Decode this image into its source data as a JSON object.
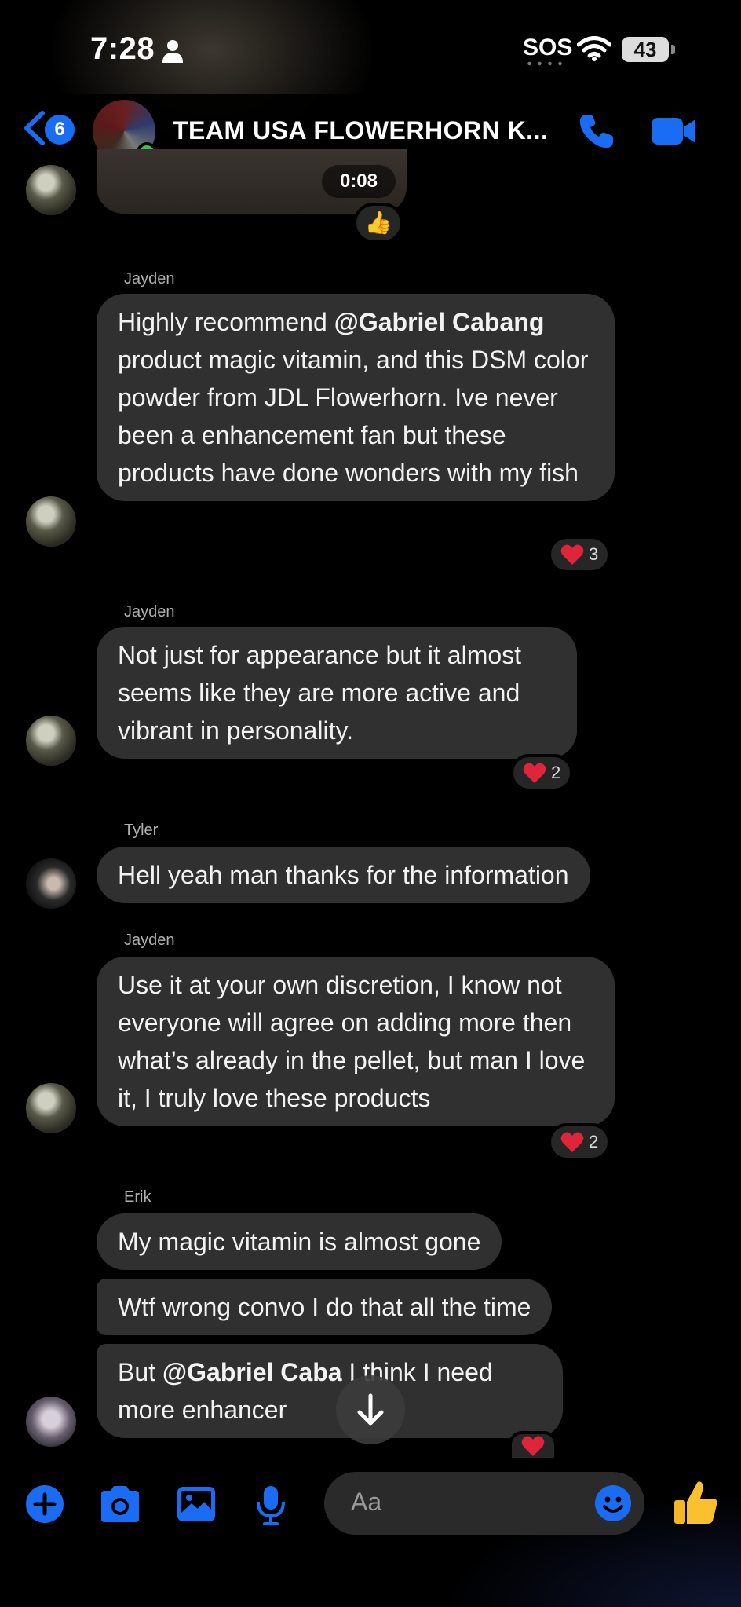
{
  "status_bar": {
    "time": "7:28",
    "sos": "SOS",
    "battery": "43"
  },
  "header": {
    "back_badge": "6",
    "title": "TEAM USA FLOWERHORN K..."
  },
  "video": {
    "duration": "0:08",
    "reaction": "👍"
  },
  "messages": [
    {
      "sender": "Jayden",
      "text_bold": "@Gabriel Cabang",
      "text_before": "Highly recommend ",
      "text_after": " product magic vitamin, and this DSM color powder from JDL Flowerhorn. Ive never been a enhancement fan but these products have done wonders with my fish",
      "reaction_count": "3"
    },
    {
      "sender": "Jayden",
      "text": "Not just for appearance but it almost seems like they are more active and vibrant in personality.",
      "reaction_count": "2"
    },
    {
      "sender": "Tyler",
      "text": "Hell yeah man thanks for the information"
    },
    {
      "sender": "Jayden",
      "text": "Use it at your own discretion, I know not everyone will agree on adding more then what’s already in the pellet, but man I love it, I truly love these products",
      "reaction_count": "2"
    },
    {
      "sender": "Erik",
      "text": "My magic vitamin is almost gone"
    },
    {
      "text": "Wtf wrong convo I do that all the time"
    },
    {
      "text_before": "But ",
      "text_bold": "@Gabriel Caba",
      "text_after": "  I think I need more enhancer"
    }
  ],
  "composer": {
    "placeholder": "Aa"
  },
  "colors": {
    "accent": "#1a6cf5",
    "bubble": "#303030",
    "heart": "#e0243a"
  }
}
